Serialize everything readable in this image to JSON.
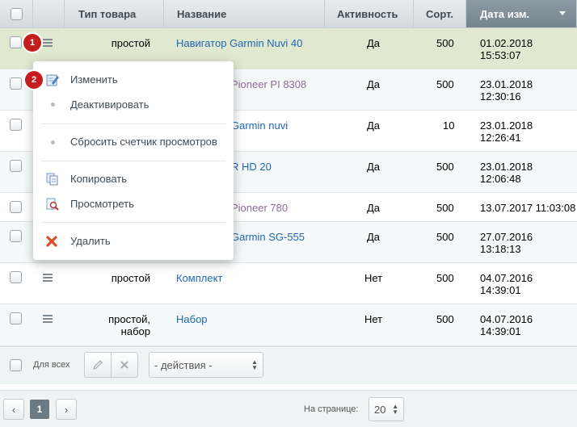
{
  "table": {
    "headers": {
      "type": "Тип товара",
      "name": "Название",
      "active": "Активность",
      "sort": "Сорт.",
      "date": "Дата изм."
    },
    "rows": [
      {
        "type": "простой",
        "name": "Навигатор Garmin Nuvi 40",
        "active": "Да",
        "sort": "500",
        "date1": "01.02.2018",
        "date2": "15:53:07"
      },
      {
        "type": "",
        "name": "Pioneer PI 8308",
        "active": "Да",
        "sort": "500",
        "date1": "23.01.2018",
        "date2": "12:30:16"
      },
      {
        "type": "",
        "name": "Garmin nuvi",
        "active": "Да",
        "sort": "10",
        "date1": "23.01.2018",
        "date2": "12:26:41"
      },
      {
        "type": "",
        "name": "R HD 20",
        "active": "Да",
        "sort": "500",
        "date1": "23.01.2018",
        "date2": "12:06:48"
      },
      {
        "type": "",
        "name": "Pioneer 780",
        "active": "Да",
        "sort": "500",
        "date1": "13.07.2017 11:03:08",
        "date2": ""
      },
      {
        "type": "",
        "name": "Garmin SG-555",
        "active": "Да",
        "sort": "500",
        "date1": "27.07.2016",
        "date2": "13:18:13"
      },
      {
        "type": "простой",
        "name": "Комплект",
        "active": "Нет",
        "sort": "500",
        "date1": "04.07.2016",
        "date2": "14:39:01"
      },
      {
        "type1": "простой,",
        "type2": "набор",
        "name": "Набор",
        "active": "Нет",
        "sort": "500",
        "date1": "04.07.2016",
        "date2": "14:39:01"
      }
    ]
  },
  "badges": {
    "one": "1",
    "two": "2"
  },
  "context_menu": {
    "edit": "Изменить",
    "deactivate": "Деактивировать",
    "reset_counter": "Сбросить счетчик просмотров",
    "copy": "Копировать",
    "view": "Просмотреть",
    "delete": "Удалить"
  },
  "footer": {
    "for_all": "Для всех",
    "actions_select": "- действия -",
    "page_current": "1",
    "per_page_label": "На странице:",
    "per_page_value": "20"
  },
  "icons": {
    "row_menu": "hamburger-icon",
    "edit": "pencil-icon",
    "copy": "copy-icon",
    "view": "magnifier-icon",
    "delete": "red-x-icon"
  },
  "colors": {
    "link": "#2067b0",
    "badge": "#c51e1e",
    "selected_row": "#e1e8d0",
    "sorted_header": "#7d8b95"
  }
}
